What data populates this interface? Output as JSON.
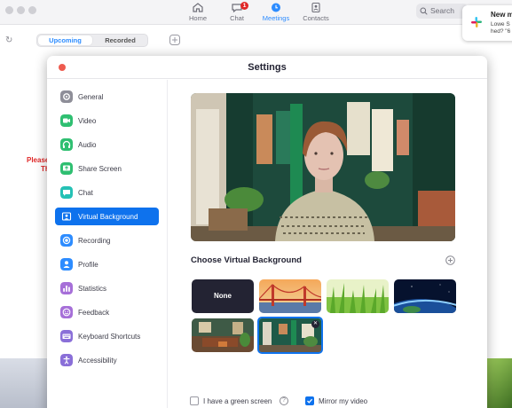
{
  "topbar": {
    "nav": [
      {
        "label": "Home",
        "icon": "home-icon"
      },
      {
        "label": "Chat",
        "icon": "chat-icon",
        "badge": "1"
      },
      {
        "label": "Meetings",
        "icon": "clock-icon",
        "active": true
      },
      {
        "label": "Contacts",
        "icon": "contacts-icon"
      }
    ],
    "search_placeholder": "Search"
  },
  "notification": {
    "app_icon": "slack-icon",
    "title": "New m",
    "line1": "Lowe S",
    "line2": "hed? \"6"
  },
  "meetings_panel": {
    "tabs": [
      "Upcoming",
      "Recorded"
    ],
    "active_tab": "Upcoming",
    "notice_line1": "Please",
    "notice_line2": "Th"
  },
  "settings": {
    "title": "Settings",
    "sidebar": [
      {
        "label": "General",
        "icon": "gear-icon",
        "color": "#8e8e98"
      },
      {
        "label": "Video",
        "icon": "video-icon",
        "color": "#2fbf71"
      },
      {
        "label": "Audio",
        "icon": "headphones-icon",
        "color": "#2fbf71"
      },
      {
        "label": "Share Screen",
        "icon": "share-screen-icon",
        "color": "#2fbf71"
      },
      {
        "label": "Chat",
        "icon": "chat-bubble-icon",
        "color": "#25c1b5"
      },
      {
        "label": "Virtual Background",
        "icon": "portrait-icon",
        "color": "#0e72ed",
        "active": true
      },
      {
        "label": "Recording",
        "icon": "record-icon",
        "color": "#2d8cff"
      },
      {
        "label": "Profile",
        "icon": "person-icon",
        "color": "#2d8cff"
      },
      {
        "label": "Statistics",
        "icon": "bar-chart-icon",
        "color": "#a66fd8"
      },
      {
        "label": "Feedback",
        "icon": "smile-icon",
        "color": "#a66fd8"
      },
      {
        "label": "Keyboard Shortcuts",
        "icon": "keyboard-icon",
        "color": "#8a6fd8"
      },
      {
        "label": "Accessibility",
        "icon": "accessibility-icon",
        "color": "#8a6fd8"
      }
    ],
    "choose_heading": "Choose Virtual Background",
    "backgrounds": [
      {
        "label": "None",
        "kind": "none"
      },
      {
        "label": "",
        "kind": "golden-gate"
      },
      {
        "label": "",
        "kind": "grass"
      },
      {
        "label": "",
        "kind": "earth"
      },
      {
        "label": "",
        "kind": "living-room"
      },
      {
        "label": "",
        "kind": "green-room",
        "selected": true
      }
    ],
    "green_screen_label": "I have a green screen",
    "green_screen_checked": false,
    "mirror_label": "Mirror my video",
    "mirror_checked": true
  }
}
